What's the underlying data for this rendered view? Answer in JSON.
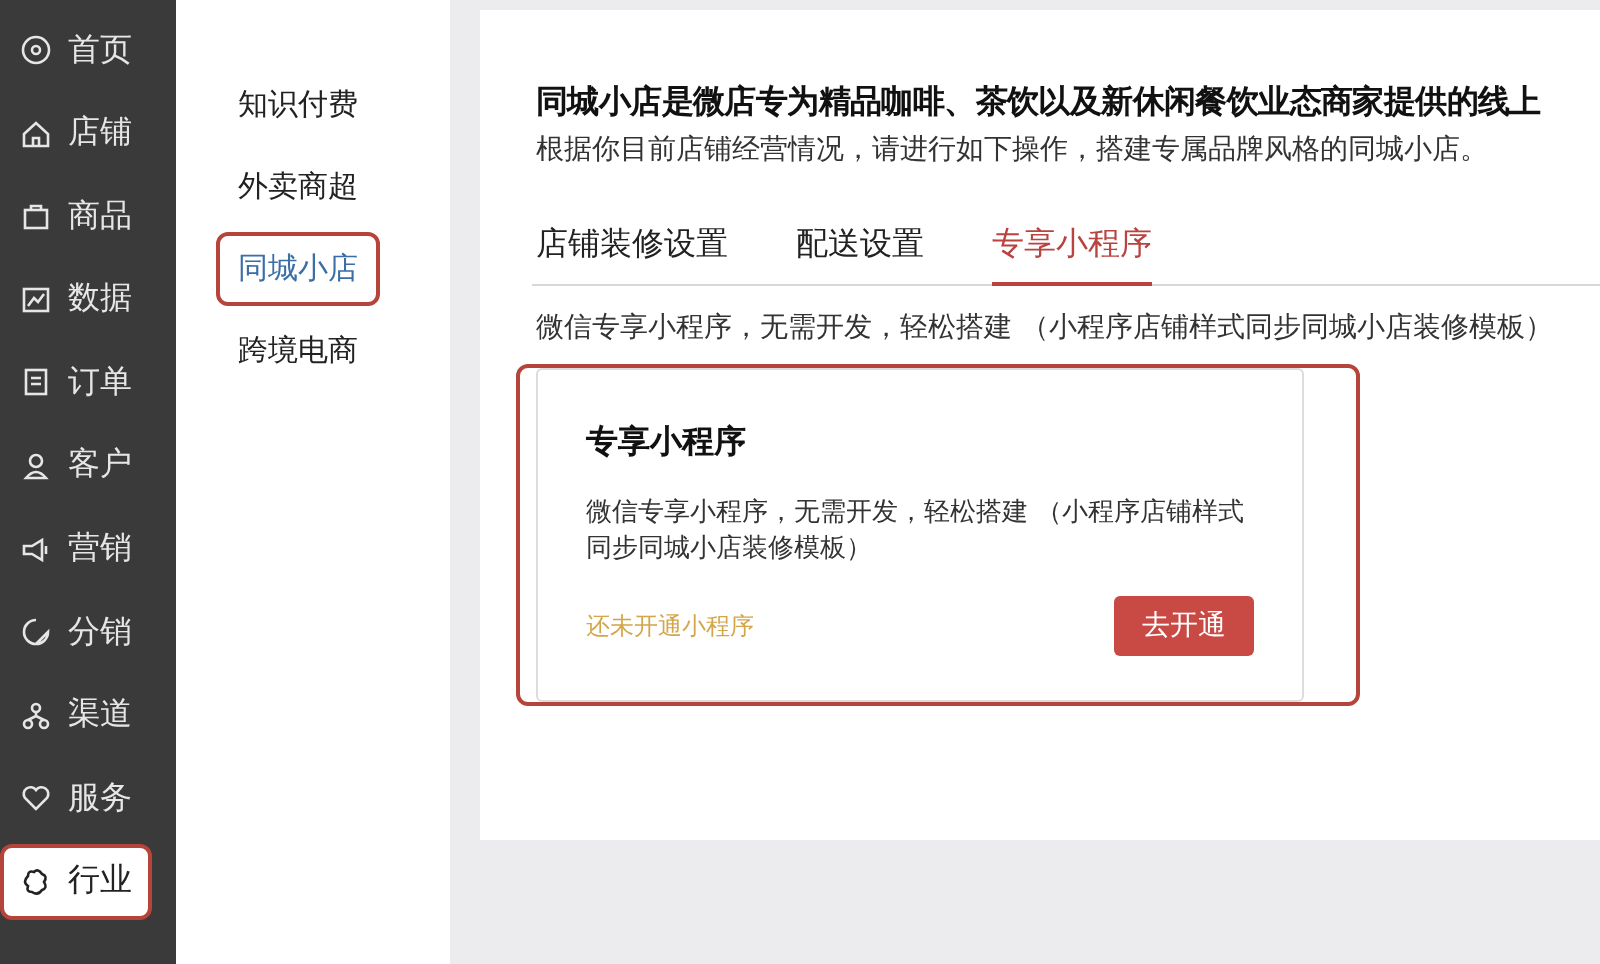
{
  "nav": [
    {
      "label": "首页",
      "selected": false,
      "highlighted": false
    },
    {
      "label": "店铺",
      "selected": false,
      "highlighted": false
    },
    {
      "label": "商品",
      "selected": false,
      "highlighted": false
    },
    {
      "label": "数据",
      "selected": false,
      "highlighted": false
    },
    {
      "label": "订单",
      "selected": false,
      "highlighted": false
    },
    {
      "label": "客户",
      "selected": false,
      "highlighted": false
    },
    {
      "label": "营销",
      "selected": false,
      "highlighted": false
    },
    {
      "label": "分销",
      "selected": false,
      "highlighted": false
    },
    {
      "label": "渠道",
      "selected": false,
      "highlighted": false
    },
    {
      "label": "服务",
      "selected": false,
      "highlighted": false
    },
    {
      "label": "行业",
      "selected": true,
      "highlighted": true
    }
  ],
  "submenu": [
    {
      "label": "知识付费",
      "selected": false,
      "highlighted": false
    },
    {
      "label": "外卖商超",
      "selected": false,
      "highlighted": false
    },
    {
      "label": "同城小店",
      "selected": true,
      "highlighted": true
    },
    {
      "label": "跨境电商",
      "selected": false,
      "highlighted": false
    }
  ],
  "intro": {
    "title": "同城小店是微店专为精品咖啡、茶饮以及新休闲餐饮业态商家提供的线上",
    "subtitle": "根据你目前店铺经营情况，请进行如下操作，搭建专属品牌风格的同城小店。"
  },
  "tabs": [
    {
      "label": "店铺装修设置",
      "selected": false
    },
    {
      "label": "配送设置",
      "selected": false
    },
    {
      "label": "专享小程序",
      "selected": true
    }
  ],
  "tab_description": "微信专享小程序，无需开发，轻松搭建 （小程序店铺样式同步同城小店装修模板）",
  "card": {
    "highlighted": true,
    "title": "专享小程序",
    "description": "微信专享小程序，无需开发，轻松搭建 （小程序店铺样式同步同城小店装修模板）",
    "status": "还未开通小程序",
    "button": "去开通"
  }
}
